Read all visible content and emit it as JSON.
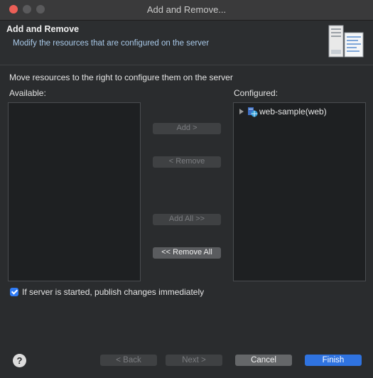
{
  "window": {
    "title": "Add and Remove..."
  },
  "header": {
    "title": "Add and Remove",
    "description": "Modify the resources that are configured on the server"
  },
  "instruction": "Move resources to the right to configure them on the server",
  "available": {
    "label": "Available:",
    "items": []
  },
  "configured": {
    "label": "Configured:",
    "items": [
      {
        "label": "web-sample(web)",
        "icon": "web-module-icon",
        "expanded": false
      }
    ]
  },
  "buttons": {
    "add": "Add >",
    "remove": "< Remove",
    "add_all": "Add All >>",
    "remove_all": "<< Remove All"
  },
  "publish_option": {
    "label": "If server is started, publish changes immediately",
    "checked": true
  },
  "footer": {
    "help": "?",
    "back": "< Back",
    "next": "Next >",
    "cancel": "Cancel",
    "finish": "Finish"
  },
  "colors": {
    "accent": "#2f73e0",
    "close_button": "#ec5f57",
    "checkbox": "#2f7bf5"
  }
}
